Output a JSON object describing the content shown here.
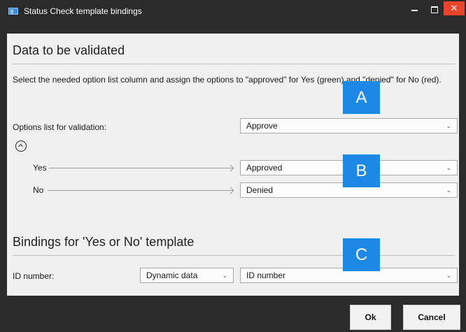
{
  "window": {
    "title": "Status Check template bindings",
    "controls": {
      "minimize": "–",
      "maximize": "□",
      "close": "✕"
    }
  },
  "sections": {
    "validated": {
      "title": "Data to be validated",
      "description": "Select the needed option list column and assign the options to \"approved\" for Yes (green) and \"denied\" for No (red).",
      "options_label": "Options list for validation:",
      "options_value": "Approve",
      "mappings": [
        {
          "label": "Yes",
          "value": "Approved"
        },
        {
          "label": "No",
          "value": "Denied"
        }
      ]
    },
    "bindings": {
      "title": "Bindings for 'Yes or No' template",
      "id_label": "ID number:",
      "source_value": "Dynamic data",
      "field_value": "ID number"
    }
  },
  "callouts": [
    "A",
    "B",
    "C"
  ],
  "buttons": {
    "ok": "Ok",
    "cancel": "Cancel"
  },
  "icons": {
    "app": "form-icon",
    "collapse": "chevron-up-circle-icon",
    "dropdown": "chevron-down-icon"
  },
  "colors": {
    "titlebar": "#2b2b2b",
    "close": "#e8452c",
    "callout": "#1e88e5",
    "panel": "#f0f0f0"
  }
}
